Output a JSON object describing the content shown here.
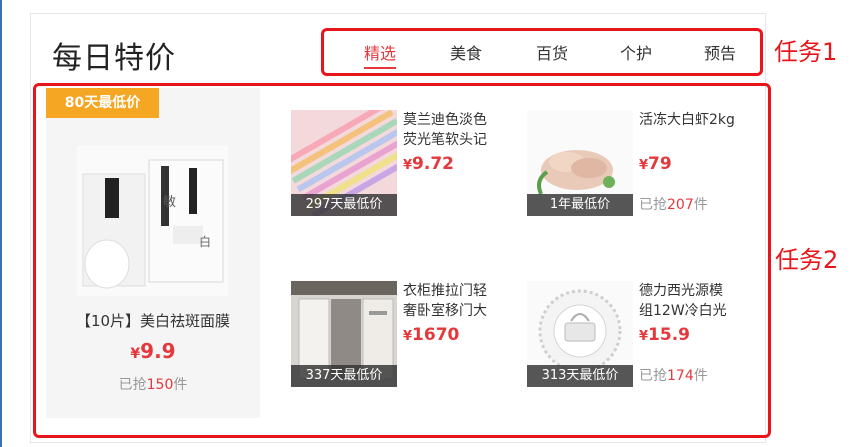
{
  "header": {
    "title": "每日特价",
    "tabs": [
      {
        "label": "精选",
        "active": true
      },
      {
        "label": "美食",
        "active": false
      },
      {
        "label": "百货",
        "active": false
      },
      {
        "label": "个护",
        "active": false
      },
      {
        "label": "预告",
        "active": false
      }
    ]
  },
  "annotations": {
    "task1": "任务1",
    "task2": "任务2",
    "color": "#e8161a"
  },
  "featured": {
    "ribbon": "80天最低价",
    "name": "【10片】美白祛斑面膜",
    "currency": "¥",
    "price": "9.9",
    "sold_prefix": "已抢",
    "sold_count": "150",
    "sold_suffix": "件"
  },
  "products": [
    {
      "name": "莫兰迪色淡色荧光笔软头记",
      "currency": "¥",
      "price": "9.72",
      "badge": "297天最低价",
      "sold_prefix": "",
      "sold_count": "",
      "sold_suffix": "",
      "image": "pastel-highlighters"
    },
    {
      "name": "活冻大白虾2kg",
      "currency": "¥",
      "price": "79",
      "badge": "1年最低价",
      "sold_prefix": "已抢",
      "sold_count": "207",
      "sold_suffix": "件",
      "image": "shrimp"
    },
    {
      "name": "衣柜推拉门轻奢卧室移门大",
      "currency": "¥",
      "price": "1670",
      "badge": "337天最低价",
      "sold_prefix": "",
      "sold_count": "",
      "sold_suffix": "",
      "image": "wardrobe"
    },
    {
      "name": "德力西光源模组12W冷白光",
      "currency": "¥",
      "price": "15.9",
      "badge": "313天最低价",
      "sold_prefix": "已抢",
      "sold_count": "174",
      "sold_suffix": "件",
      "image": "led-module"
    }
  ],
  "colors": {
    "accent_red": "#e4393c",
    "ribbon_orange": "#f5a623"
  }
}
